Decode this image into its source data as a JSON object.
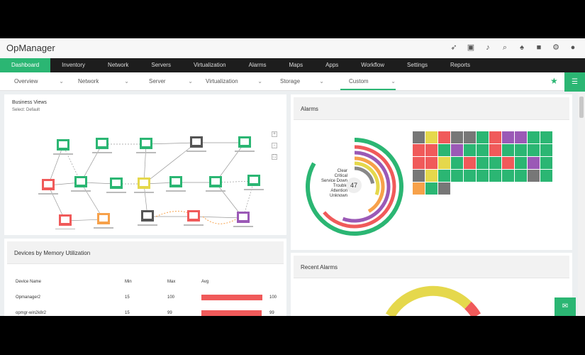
{
  "app": {
    "title": "OpManager"
  },
  "toolbar_icons": [
    "rocket-icon",
    "monitor-icon",
    "mic-icon",
    "search-icon",
    "bell-icon",
    "video-icon",
    "gear-icon",
    "user-icon"
  ],
  "main_nav": [
    {
      "label": "Dashboard",
      "active": true
    },
    {
      "label": "Inventory"
    },
    {
      "label": "Network"
    },
    {
      "label": "Servers"
    },
    {
      "label": "Virtualization"
    },
    {
      "label": "Alarms"
    },
    {
      "label": "Maps"
    },
    {
      "label": "Apps"
    },
    {
      "label": "Workflow"
    },
    {
      "label": "Settings"
    },
    {
      "label": "Reports"
    }
  ],
  "sub_nav": [
    {
      "label": "Overview"
    },
    {
      "label": "Network"
    },
    {
      "label": "Server"
    },
    {
      "label": "Virtualization"
    },
    {
      "label": "Storage"
    },
    {
      "label": "Custom",
      "active": true
    }
  ],
  "business_view": {
    "title": "Business Views",
    "subtitle": "Select: Default",
    "nodes": [
      {
        "label": "",
        "color": "#2bb673"
      },
      {
        "label": "",
        "color": "#2bb673"
      },
      {
        "label": "",
        "color": "#2bb673"
      },
      {
        "label": "",
        "color": "#555555"
      },
      {
        "label": "",
        "color": "#2bb673"
      },
      {
        "label": "",
        "color": "#f05a5a"
      },
      {
        "label": "",
        "color": "#2bb673"
      },
      {
        "label": "",
        "color": "#2bb673"
      },
      {
        "label": "",
        "color": "#e5d84c"
      },
      {
        "label": "",
        "color": "#2bb673"
      },
      {
        "label": "",
        "color": "#2bb673"
      },
      {
        "label": "",
        "color": "#2bb673"
      },
      {
        "label": "",
        "color": "#f05a5a"
      },
      {
        "label": "",
        "color": "#f7a14a"
      },
      {
        "label": "",
        "color": "#555555"
      },
      {
        "label": "",
        "color": "#f05a5a"
      },
      {
        "label": "",
        "color": "#9b59b6"
      }
    ]
  },
  "alarms_panel": {
    "title": "Alarms",
    "total": "47",
    "legend": [
      "Clear",
      "Critical",
      "Service Down",
      "Trouble",
      "Attention",
      "Unknown"
    ],
    "ring_colors": [
      "#2bb673",
      "#f05a5a",
      "#9b59b6",
      "#f7a14a",
      "#e5d84c",
      "#888888"
    ],
    "heatmap_colors": [
      [
        "#777777",
        "#e5d84c",
        "#f05a5a",
        "#777777",
        "#777777",
        "#2bb673",
        "#f05a5a",
        "#9b59b6",
        "#9b59b6",
        "#2bb673",
        "#2bb673"
      ],
      [
        "#f05a5a",
        "#f05a5a",
        "#2bb673",
        "#9b59b6",
        "#2bb673",
        "#2bb673",
        "#f05a5a",
        "#2bb673",
        "#2bb673",
        "#2bb673",
        "#2bb673"
      ],
      [
        "#f05a5a",
        "#f05a5a",
        "#e5d84c",
        "#2bb673",
        "#f05a5a",
        "#2bb673",
        "#2bb673",
        "#f05a5a",
        "#2bb673",
        "#9b59b6",
        "#2bb673"
      ],
      [
        "#777777",
        "#e5d84c",
        "#2bb673",
        "#2bb673",
        "#2bb673",
        "#2bb673",
        "#2bb673",
        "#2bb673",
        "#2bb673",
        "#777777",
        "#2bb673"
      ],
      [
        "#f7a14a",
        "#2bb673",
        "#777777"
      ]
    ]
  },
  "memory_panel": {
    "title": "Devices by Memory Utilization",
    "columns": [
      "Device Name",
      "Min",
      "Max",
      "Avg"
    ],
    "rows": [
      {
        "device": "Opmanager2",
        "min": "15",
        "max": "100",
        "avg": "100",
        "pct": 1.0
      },
      {
        "device": "opmgr-win2k8r2",
        "min": "15",
        "max": "99",
        "avg": "99",
        "pct": 0.99
      }
    ]
  },
  "recent_alarms": {
    "title": "Recent Alarms"
  }
}
